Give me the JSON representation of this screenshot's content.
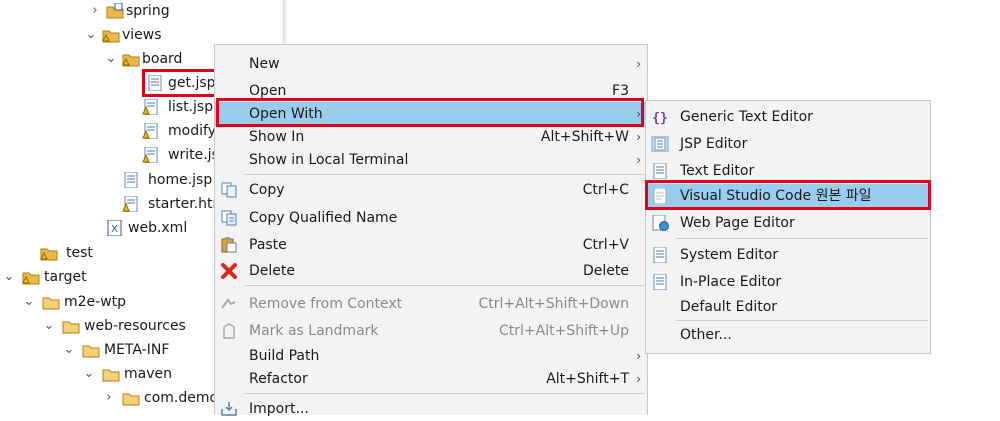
{
  "tree": {
    "items": [
      {
        "label": "spring",
        "icon": "package-folder-icon",
        "expanded": false
      },
      {
        "label": "views",
        "icon": "warning-folder-icon",
        "expanded": true
      },
      {
        "label": "board",
        "icon": "warning-folder-icon",
        "expanded": true
      },
      {
        "label": "get.jsp",
        "icon": "jsp-file-icon"
      },
      {
        "label": "list.jsp",
        "icon": "warning-file-icon"
      },
      {
        "label": "modify",
        "icon": "warning-file-icon"
      },
      {
        "label": "write.js",
        "icon": "warning-file-icon"
      },
      {
        "label": "home.jsp",
        "icon": "jsp-file-icon"
      },
      {
        "label": "starter.htn",
        "icon": "warning-file-icon"
      },
      {
        "label": "web.xml",
        "icon": "xml-file-icon"
      },
      {
        "label": "test",
        "icon": "warning-folder-icon"
      },
      {
        "label": "target",
        "icon": "warning-folder-icon",
        "expanded": true
      },
      {
        "label": "m2e-wtp",
        "icon": "folder-icon",
        "expanded": true
      },
      {
        "label": "web-resources",
        "icon": "folder-icon",
        "expanded": true
      },
      {
        "label": "META-INF",
        "icon": "folder-icon",
        "expanded": true
      },
      {
        "label": "maven",
        "icon": "folder-icon",
        "expanded": true
      },
      {
        "label": "com.demo",
        "icon": "folder-icon",
        "expanded": false
      }
    ]
  },
  "context_menu": {
    "items": [
      {
        "label": "New",
        "shortcut": "",
        "submenu": true
      },
      {
        "label": "Open",
        "shortcut": "F3"
      },
      {
        "label": "Open With",
        "shortcut": "",
        "submenu": true,
        "highlighted": true
      },
      {
        "label": "Show In",
        "shortcut": "Alt+Shift+W",
        "submenu": true
      },
      {
        "label": "Show in Local Terminal",
        "shortcut": "",
        "submenu": true
      },
      {
        "label": "Copy",
        "shortcut": "Ctrl+C",
        "icon": "copy-icon"
      },
      {
        "label": "Copy Qualified Name",
        "shortcut": "",
        "icon": "copy-qualified-icon"
      },
      {
        "label": "Paste",
        "shortcut": "Ctrl+V",
        "icon": "paste-icon"
      },
      {
        "label": "Delete",
        "shortcut": "Delete",
        "icon": "delete-icon"
      },
      {
        "label": "Remove from Context",
        "shortcut": "Ctrl+Alt+Shift+Down",
        "disabled": true,
        "icon": "remove-context-icon"
      },
      {
        "label": "Mark as Landmark",
        "shortcut": "Ctrl+Alt+Shift+Up",
        "disabled": true,
        "icon": "landmark-icon"
      },
      {
        "label": "Build Path",
        "shortcut": "",
        "submenu": true
      },
      {
        "label": "Refactor",
        "shortcut": "Alt+Shift+T",
        "submenu": true
      },
      {
        "label": "Import...",
        "shortcut": "",
        "icon": "import-icon"
      }
    ]
  },
  "open_with_menu": {
    "items": [
      {
        "label": "Generic Text Editor",
        "icon": "generic-editor-icon"
      },
      {
        "label": "JSP Editor",
        "icon": "jsp-editor-icon"
      },
      {
        "label": "Text Editor",
        "icon": "text-editor-icon"
      },
      {
        "label": "Visual Studio Code 원본 파일",
        "icon": "vscode-file-icon",
        "highlighted": true
      },
      {
        "label": "Web Page Editor",
        "icon": "web-page-editor-icon"
      },
      {
        "label": "System Editor",
        "icon": "system-editor-icon"
      },
      {
        "label": "In-Place Editor",
        "icon": "in-place-editor-icon"
      },
      {
        "label": "Default Editor",
        "icon": ""
      },
      {
        "label": "Other...",
        "icon": ""
      }
    ]
  },
  "colors": {
    "highlight": "#99cdee",
    "annotation_red": "#e3001b",
    "menu_bg": "#f3f3f3"
  }
}
